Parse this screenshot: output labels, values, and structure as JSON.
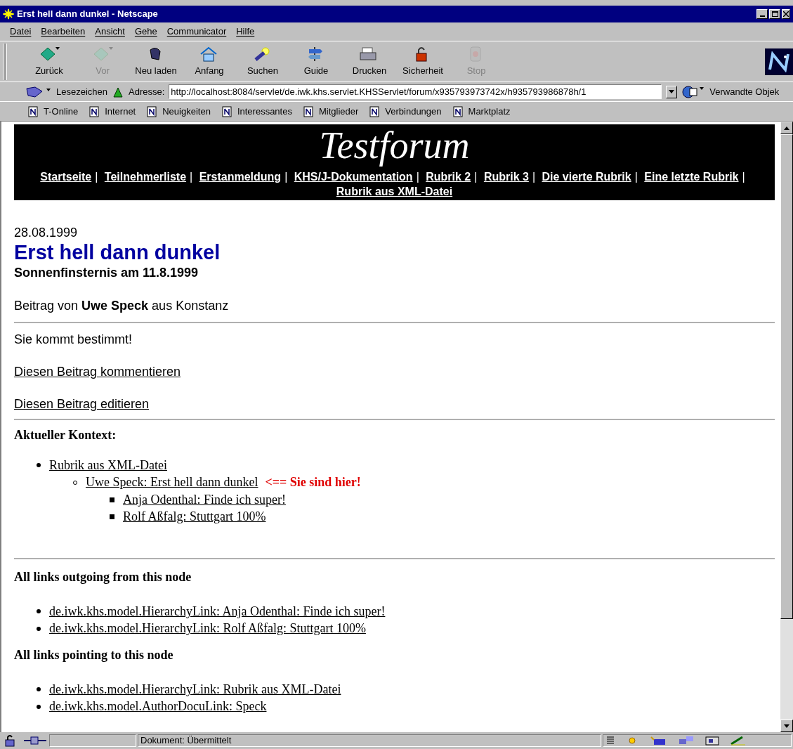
{
  "window": {
    "title": "Erst hell dann dunkel - Netscape"
  },
  "menu": [
    "Datei",
    "Bearbeiten",
    "Ansicht",
    "Gehe",
    "Communicator",
    "Hilfe"
  ],
  "toolbar": [
    {
      "label": "Zurück",
      "disabled": false
    },
    {
      "label": "Vor",
      "disabled": true
    },
    {
      "label": "Neu laden",
      "disabled": false
    },
    {
      "label": "Anfang",
      "disabled": false
    },
    {
      "label": "Suchen",
      "disabled": false
    },
    {
      "label": "Guide",
      "disabled": false
    },
    {
      "label": "Drucken",
      "disabled": false
    },
    {
      "label": "Sicherheit",
      "disabled": false
    },
    {
      "label": "Stop",
      "disabled": true
    }
  ],
  "location_bar": {
    "bookmarks": "Lesezeichen",
    "address_label": "Adresse:",
    "url": "http://localhost:8084/servlet/de.iwk.khs.servlet.KHSServlet/forum/x935793973742x/h935793986878h/1",
    "related": "Verwandte Objek"
  },
  "personal_bar": [
    "T-Online",
    "Internet",
    "Neuigkeiten",
    "Interessantes",
    "Mitglieder",
    "Verbindungen",
    "Marktplatz"
  ],
  "page": {
    "site_title": "Testforum",
    "nav_separator": "|",
    "nav_links": [
      "Startseite",
      "Teilnehmerliste",
      "Erstanmeldung",
      "KHS/J-Dokumentation",
      "Rubrik 2",
      "Rubrik 3",
      "Die vierte Rubrik",
      "Eine letzte Rubrik",
      "Rubrik aus XML-Datei"
    ],
    "date": "28.08.1999",
    "heading": "Erst hell dann dunkel",
    "subheading": "Sonnenfinsternis am 11.8.1999",
    "byline": "Beitrag von **Uwe Speck** aus Konstanz",
    "body": "Sie kommt bestimmt!",
    "actions": [
      "Diesen Beitrag kommentieren",
      "Diesen Beitrag editieren"
    ],
    "context": {
      "heading": "Aktueller Kontext:",
      "tree": [
        {
          "label": "Rubrik aus XML-Datei",
          "current": false,
          "children": [
            {
              "label": "Uwe Speck: Erst hell dann dunkel",
              "current": true,
              "children": [
                {
                  "label": "Anja Odenthal: Finde ich super!",
                  "current": false
                },
                {
                  "label": "Rolf Aßfalg: Stuttgart 100%",
                  "current": false
                }
              ]
            }
          ]
        }
      ],
      "marker": "<== Sie sind hier!"
    },
    "outgoing": {
      "heading": "All links outgoing from this node",
      "links": [
        "de.iwk.khs.model.HierarchyLink: Anja Odenthal: Finde ich super!",
        "de.iwk.khs.model.HierarchyLink: Rolf Aßfalg: Stuttgart 100%"
      ]
    },
    "pointing": {
      "heading": "All links pointing to this node",
      "links": [
        "de.iwk.khs.model.HierarchyLink: Rubrik aus XML-Datei",
        "de.iwk.khs.model.AuthorDocuLink: Speck"
      ]
    }
  },
  "status_bar": {
    "text": "Dokument: Übermittelt"
  }
}
